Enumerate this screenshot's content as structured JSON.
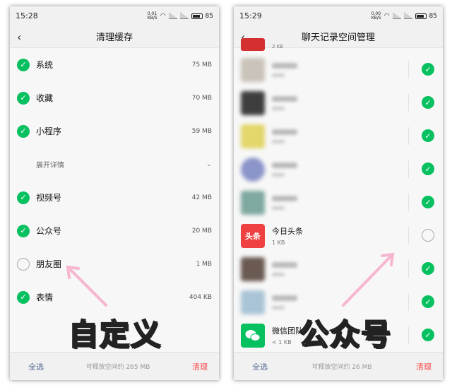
{
  "left_screen": {
    "status_time": "15:28",
    "battery": "85",
    "net_speed": "0.01 KB/S",
    "title": "清理缓存",
    "items": [
      {
        "label": "系统",
        "size": "75 MB",
        "checked": true
      },
      {
        "label": "收藏",
        "size": "70 MB",
        "checked": true
      },
      {
        "label": "小程序",
        "size": "59 MB",
        "checked": true
      },
      {
        "label": "视频号",
        "size": "42 MB",
        "checked": true
      },
      {
        "label": "公众号",
        "size": "20 MB",
        "checked": true
      },
      {
        "label": "朋友圈",
        "size": "1 MB",
        "checked": false
      },
      {
        "label": "表情",
        "size": "404 KB",
        "checked": true
      }
    ],
    "details_label": "展开详情",
    "select_all": "全选",
    "free_space": "可释放空间约 265 MB",
    "clean": "清理"
  },
  "right_screen": {
    "status_time": "15:29",
    "battery": "85",
    "net_speed": "0.00 KB/S",
    "title": "聊天记录空间管理",
    "top_partial_size": "2 KB",
    "chats": [
      {
        "name": "今日头条",
        "size": "1 KB",
        "checked": false,
        "avatar_text": "头条"
      },
      {
        "name": "微信团队",
        "size": "< 1 KB",
        "checked": true
      }
    ],
    "select_all": "全选",
    "free_space": "可释放空间约 26 MB",
    "clean": "清理"
  },
  "captions": {
    "left": "自定义",
    "right": "公众号"
  },
  "colors": {
    "check_green": "#07c160",
    "clean_red": "#fa5151",
    "select_blue": "#576b95",
    "arrow_pink": "#f7b6cf"
  }
}
